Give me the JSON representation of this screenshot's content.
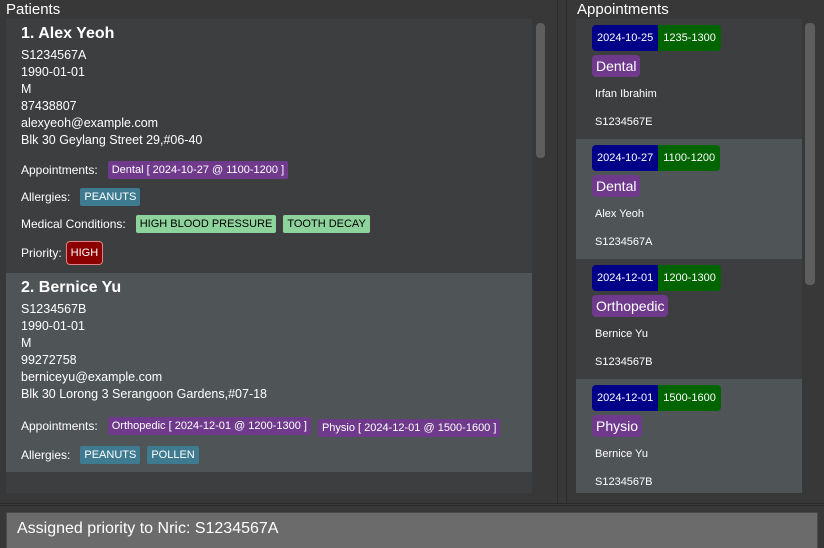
{
  "patients_panel": {
    "title": "Patients",
    "labels": {
      "appointments": "Appointments:",
      "allergies": "Allergies:",
      "medical_conditions": "Medical Conditions:",
      "priority": "Priority:"
    },
    "patients": [
      {
        "name": "1.  Alex Yeoh",
        "nric": "S1234567A",
        "dob": "1990-01-01",
        "sex": "M",
        "phone": "87438807",
        "email": "alexyeoh@example.com",
        "address": "Blk 30 Geylang Street 29,#06-40",
        "appointments": [
          "Dental [ 2024-10-27 @ 1100-1200 ]"
        ],
        "allergies": [
          "PEANUTS"
        ],
        "medical_conditions": [
          "HIGH BLOOD PRESSURE",
          "TOOTH DECAY"
        ],
        "priority": "HIGH"
      },
      {
        "name": "2.  Bernice Yu",
        "nric": "S1234567B",
        "dob": "1990-01-01",
        "sex": "M",
        "phone": "99272758",
        "email": "berniceyu@example.com",
        "address": "Blk 30 Lorong 3 Serangoon Gardens,#07-18",
        "appointments": [
          "Orthopedic [ 2024-12-01 @ 1200-1300 ]",
          "Physio [ 2024-12-01 @ 1500-1600 ]"
        ],
        "allergies": [
          "PEANUTS",
          "POLLEN"
        ]
      }
    ]
  },
  "appointments_panel": {
    "title": "Appointments",
    "appointments": [
      {
        "date": "2024-10-25",
        "time": "1235-1300",
        "type": "Dental",
        "patient": "Irfan Ibrahim",
        "nric": "S1234567E"
      },
      {
        "date": "2024-10-27",
        "time": "1100-1200",
        "type": "Dental",
        "patient": "Alex Yeoh",
        "nric": "S1234567A"
      },
      {
        "date": "2024-12-01",
        "time": "1200-1300",
        "type": "Orthopedic",
        "patient": "Bernice Yu",
        "nric": "S1234567B"
      },
      {
        "date": "2024-12-01",
        "time": "1500-1600",
        "type": "Physio",
        "patient": "Bernice Yu",
        "nric": "S1234567B"
      }
    ]
  },
  "result_display": {
    "text": "Assigned priority to Nric: S1234567A"
  },
  "colors": {
    "appointment_tag": "#6f3a8c",
    "allergy_tag": "#3e7b91",
    "condition_tag": "#8ed39c",
    "priority_high": "#8b0000",
    "date_badge": "#000088",
    "time_badge": "#006400"
  }
}
